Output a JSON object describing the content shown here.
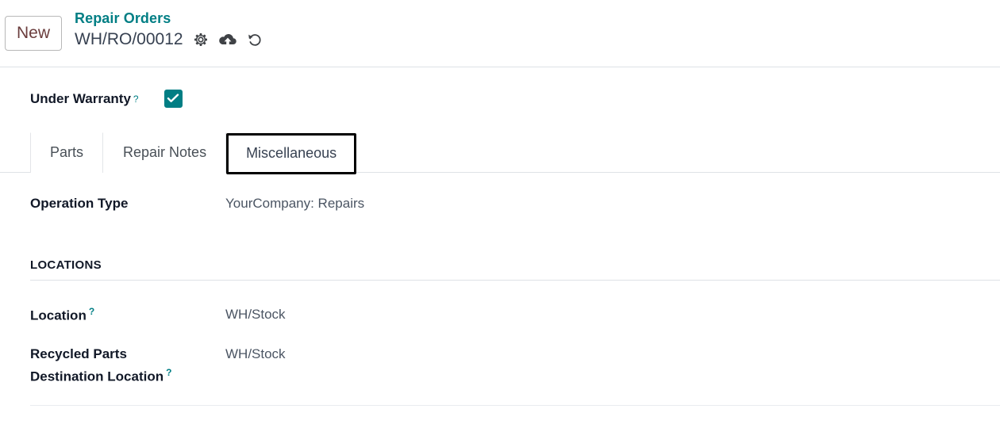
{
  "header": {
    "new_label": "New",
    "breadcrumb_parent": "Repair Orders",
    "record_name": "WH/RO/00012",
    "icons": {
      "settings": "gear-icon",
      "save": "cloud-upload-icon",
      "discard": "undo-icon"
    }
  },
  "form": {
    "under_warranty_label": "Under Warranty",
    "help_marker": "?",
    "under_warranty_checked": true
  },
  "notebook": {
    "tabs": [
      {
        "label": "Parts",
        "active": false
      },
      {
        "label": "Repair Notes",
        "active": false
      },
      {
        "label": "Miscellaneous",
        "active": true
      }
    ]
  },
  "miscellaneous": {
    "operation_type_label": "Operation Type",
    "operation_type_value": "YourCompany: Repairs",
    "locations_group_title": "LOCATIONS",
    "location_label": "Location",
    "location_value": "WH/Stock",
    "recycled_label_line1": "Recycled Parts",
    "recycled_label_line2": "Destination Location",
    "recycled_value": "WH/Stock"
  },
  "colors": {
    "accent": "#017e84",
    "text": "#374151",
    "muted": "#4b5563",
    "border": "#dee2e6"
  }
}
